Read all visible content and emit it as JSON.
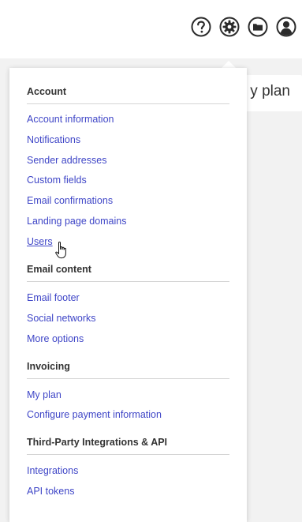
{
  "icons": {
    "help": "help-icon",
    "settings": "gear-icon",
    "folder": "folder-icon",
    "account": "user-icon"
  },
  "background": {
    "partial_text": "y plan"
  },
  "menu": {
    "sections": [
      {
        "title": "Account",
        "items": [
          "Account information",
          "Notifications",
          "Sender addresses",
          "Custom fields",
          "Email confirmations",
          "Landing page domains",
          "Users"
        ]
      },
      {
        "title": "Email content",
        "items": [
          "Email footer",
          "Social networks",
          "More options"
        ]
      },
      {
        "title": "Invoicing",
        "items": [
          "My plan",
          "Configure payment information"
        ]
      },
      {
        "title": "Third-Party Integrations & API",
        "items": [
          "Integrations",
          "API tokens"
        ]
      }
    ]
  },
  "colors": {
    "link": "#3f46c7",
    "header_text": "#333333",
    "icon": "#2b2b2b",
    "page_bg": "#f2f2f2"
  }
}
